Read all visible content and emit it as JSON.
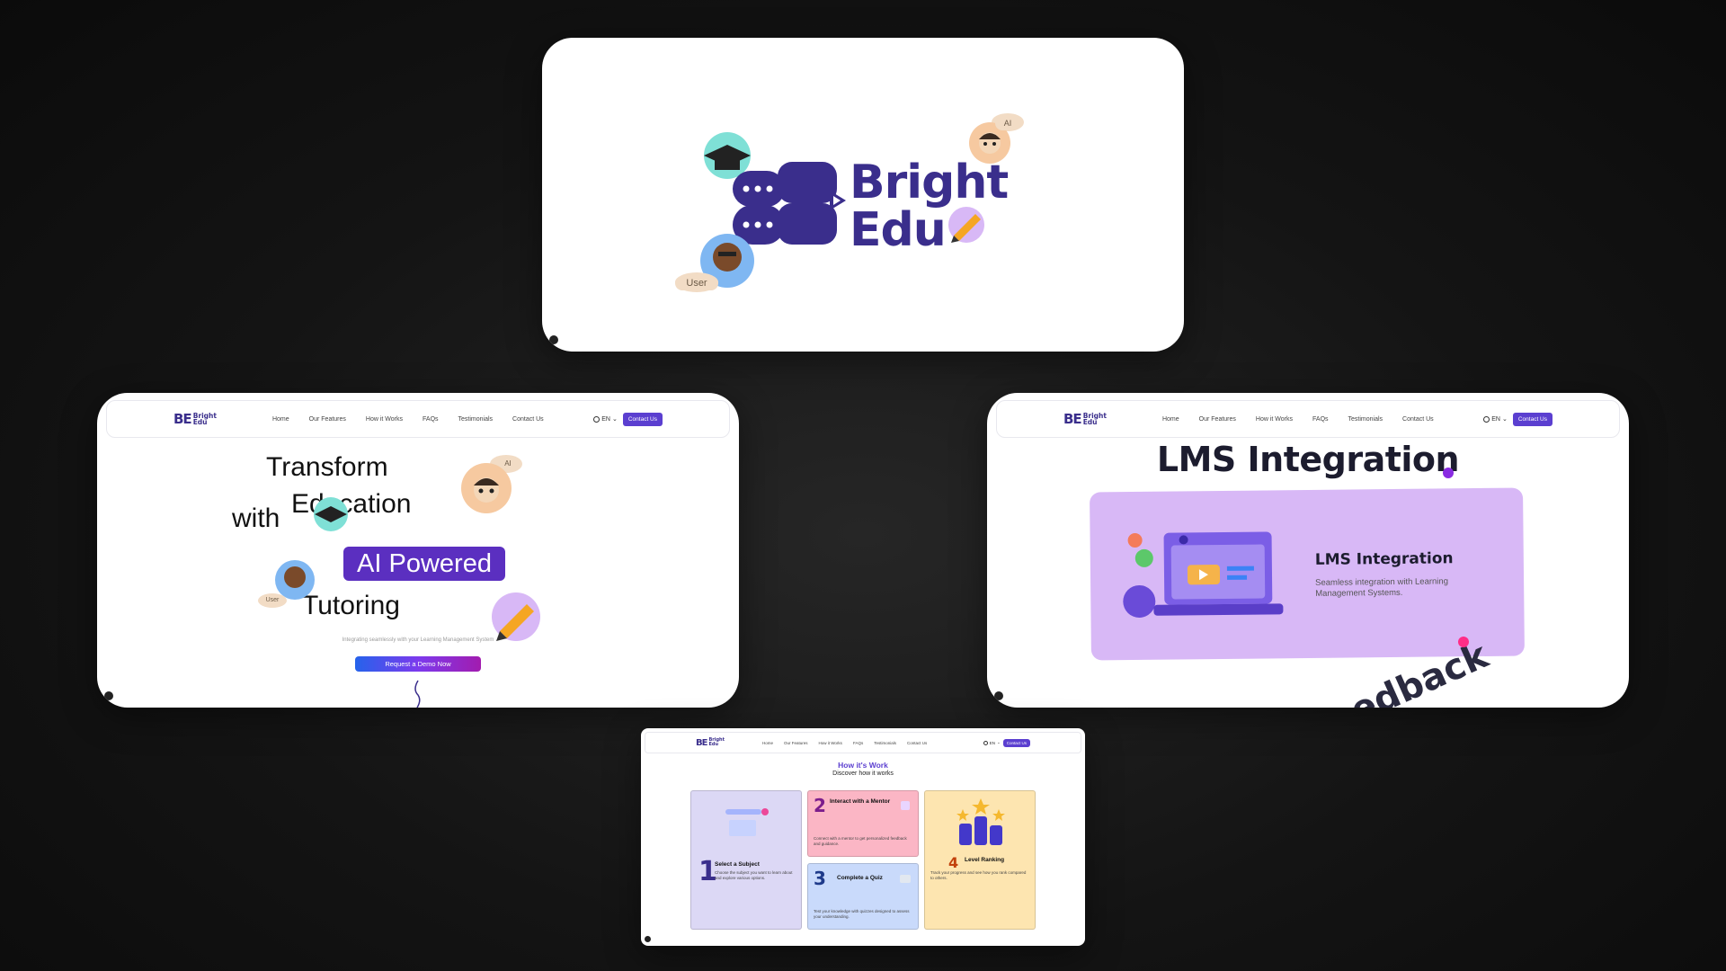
{
  "logo": {
    "mark": "BE",
    "word_top": "Bright",
    "word_bottom": "Edu",
    "tag_ai": "AI",
    "tag_user": "User",
    "colors": {
      "brand": "#3a2e8c",
      "ai_avatar_bg": "#f6c9a0",
      "user_avatar_bg": "#7fb7f2",
      "cap_bg": "#7fe0d6",
      "pencil_bg": "#d8b8f6"
    }
  },
  "nav": {
    "logo_mark": "BE",
    "logo_top": "Bright",
    "logo_bottom": "Edu",
    "links": [
      "Home",
      "Our Features",
      "How it Works",
      "FAQs",
      "Testimonials",
      "Contact Us"
    ],
    "lang": "EN",
    "contact": "Contact Us"
  },
  "hero": {
    "line1": "Transform",
    "line2": "Education",
    "with": "with",
    "highlight": "AI Powered",
    "line4": "Tutoring",
    "tag_ai": "AI",
    "tag_user": "User",
    "subtitle": "Integrating seamlessly with your Learning Management System",
    "cta": "Request a Demo Now",
    "colors": {
      "highlight_bg": "#5b2fc0"
    }
  },
  "lms": {
    "title": "LMS Integration",
    "panel_title": "LMS Integration",
    "panel_desc": "Seamless integration with Learning Management Systems.",
    "scrolling_word": "edback",
    "colors": {
      "panel_bg": "#d8b8f6",
      "dot_purple": "#8a2be2",
      "dot_pink": "#ff2d87"
    }
  },
  "how": {
    "title": "How it's Work",
    "subtitle": "Discover how it works",
    "steps": [
      {
        "num": "1",
        "title": "Select a Subject",
        "desc": "Choose the subject you want to learn about and explore various options.",
        "color": "#dcd8f5"
      },
      {
        "num": "2",
        "title": "Interact with a Mentor",
        "desc": "Connect with a mentor to get personalized feedback and guidance.",
        "color": "#fbb6c5"
      },
      {
        "num": "3",
        "title": "Complete a Quiz",
        "desc": "Test your knowledge with quizzes designed to assess your understanding.",
        "color": "#c9dafb"
      },
      {
        "num": "4",
        "title": "Level Ranking",
        "desc": "Track your progress and see how you rank compared to others.",
        "color": "#fde5b0"
      }
    ]
  }
}
